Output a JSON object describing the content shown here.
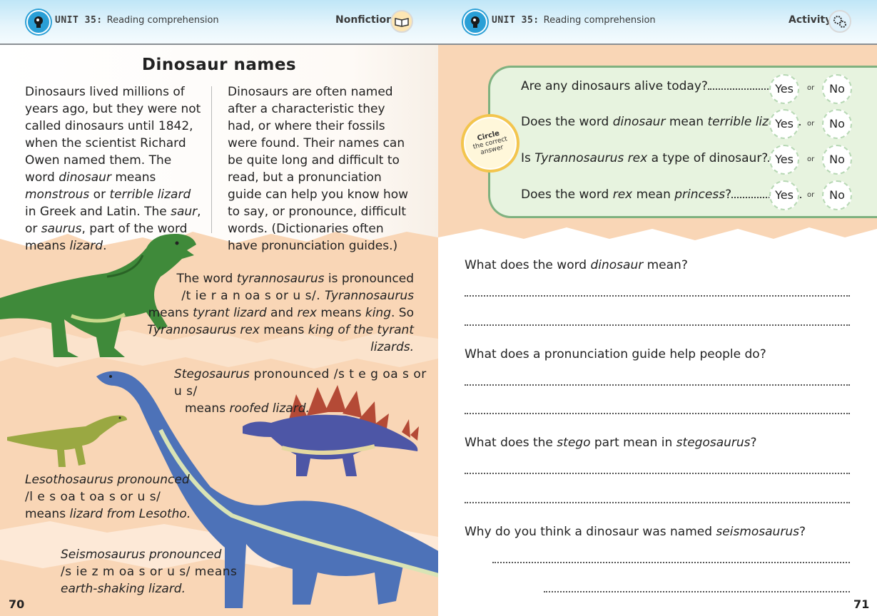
{
  "header": {
    "left": {
      "unit": "UNIT 35:",
      "subject": "Reading comprehension",
      "label": "Nonfiction"
    },
    "right": {
      "unit": "UNIT 35:",
      "subject": "Reading comprehension",
      "label": "Activity"
    }
  },
  "left_page": {
    "title": "Dinosaur names",
    "col1": {
      "p1": "Dinosaurs lived millions of years ago, but they were not called dinosaurs until 1842, when the scientist Richard Owen named them. The word ",
      "w1": "dinosaur",
      "p2": " means ",
      "w2": "monstrous",
      "p3": " or ",
      "w3": "terrible lizard",
      "p4": " in Greek and Latin. The ",
      "w4": "saur",
      "p5": ", or ",
      "w5": "saurus",
      "p6": ", part of the word means ",
      "w6": "lizard",
      "p7": "."
    },
    "col2": "Dinosaurs are often named after a characteristic they had, or where their fossils were found. Their names can be quite long and difficult to read, but a pronunciation guide can help you know how to say, or pronounce, difficult words. (Dictionaries often have pronunciation guides.)",
    "tyranno": {
      "l1a": "The word ",
      "l1b": "tyrannosaurus",
      "l1c": " is pronounced",
      "l2a": "/t ie r a n oa s or u s/. ",
      "l2b": "Tyrannosaurus",
      "l3a": "means ",
      "l3b": "tyrant lizard",
      "l3c": " and ",
      "l3d": "rex",
      "l3e": " means ",
      "l3f": "king",
      "l3g": ". So",
      "l4a": "Tyrannosaurus rex",
      "l4b": " means ",
      "l4c": "king of the tyrant lizards."
    },
    "stego": {
      "l1a": "Stegosaurus",
      "l1b": " pronounced /s t e g oa s or u s/",
      "l2a": "means ",
      "l2b": "roofed lizard."
    },
    "lesotho": {
      "l1": "Lesothosaurus pronounced",
      "l2": "/l e s oa t oa s or u s/",
      "l3a": "means ",
      "l3b": "lizard from Lesotho."
    },
    "seismo": {
      "l1": "Seismosaurus pronounced",
      "l2": "/s ie z m oa s or u s/ means",
      "l3": "earth-shaking lizard."
    },
    "page_number": "70"
  },
  "right_page": {
    "badge": {
      "l1": "Circle",
      "l2": "the correct",
      "l3": "answer"
    },
    "yes_label": "Yes",
    "no_label": "No",
    "or_label": "or",
    "yn_questions": [
      {
        "a": "Are any dinosaurs alive today?"
      },
      {
        "a": "Does the word ",
        "b": "dinosaur",
        "c": " mean ",
        "d": "terrible lizard",
        "e": "?"
      },
      {
        "a": "Is ",
        "b": "Tyrannosaurus rex",
        "c": " a type of dinosaur?"
      },
      {
        "a": "Does the word ",
        "b": "rex",
        "c": " mean ",
        "d": "princess",
        "e": "?"
      }
    ],
    "written_questions": [
      {
        "a": "What does the word ",
        "b": "dinosaur",
        "c": " mean?"
      },
      {
        "a": "What does a pronunciation guide help people do?"
      },
      {
        "a": "What does the ",
        "b": "stego",
        "c": " part mean in ",
        "d": "stegosaurus",
        "e": "?"
      },
      {
        "a": "Why do you think a dinosaur was named ",
        "b": "seismosaurus",
        "c": "?"
      }
    ],
    "page_number": "71"
  },
  "colors": {
    "header_blue": "#2a9fd6",
    "peach": "#f9d6b6",
    "question_box": "#e7f3df",
    "question_border": "#7fb17f",
    "badge_gold": "#f3c54e"
  }
}
